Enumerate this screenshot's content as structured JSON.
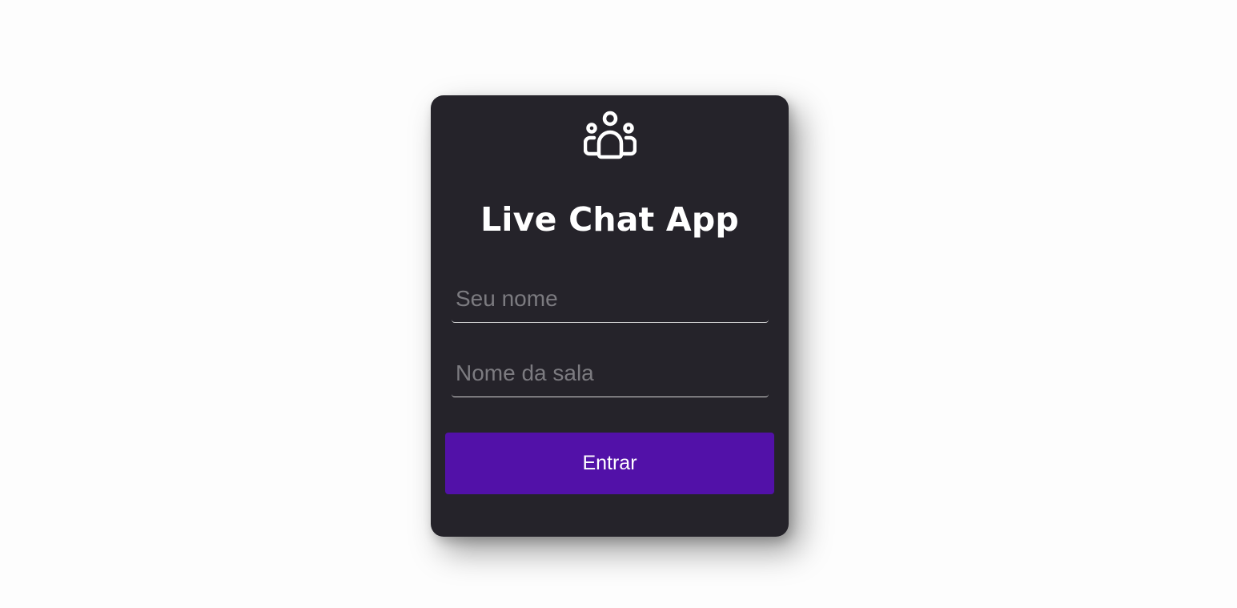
{
  "app": {
    "title": "Live Chat App",
    "logo_icon": "users-group-icon"
  },
  "form": {
    "name_placeholder": "Seu nome",
    "name_value": "",
    "room_placeholder": "Nome da sala",
    "room_value": "",
    "submit_label": "Entrar"
  },
  "colors": {
    "page_background": "#fdfdfd",
    "card_background": "#25232a",
    "accent": "#5211a8",
    "text": "#ffffff",
    "placeholder": "#7c7b80"
  }
}
